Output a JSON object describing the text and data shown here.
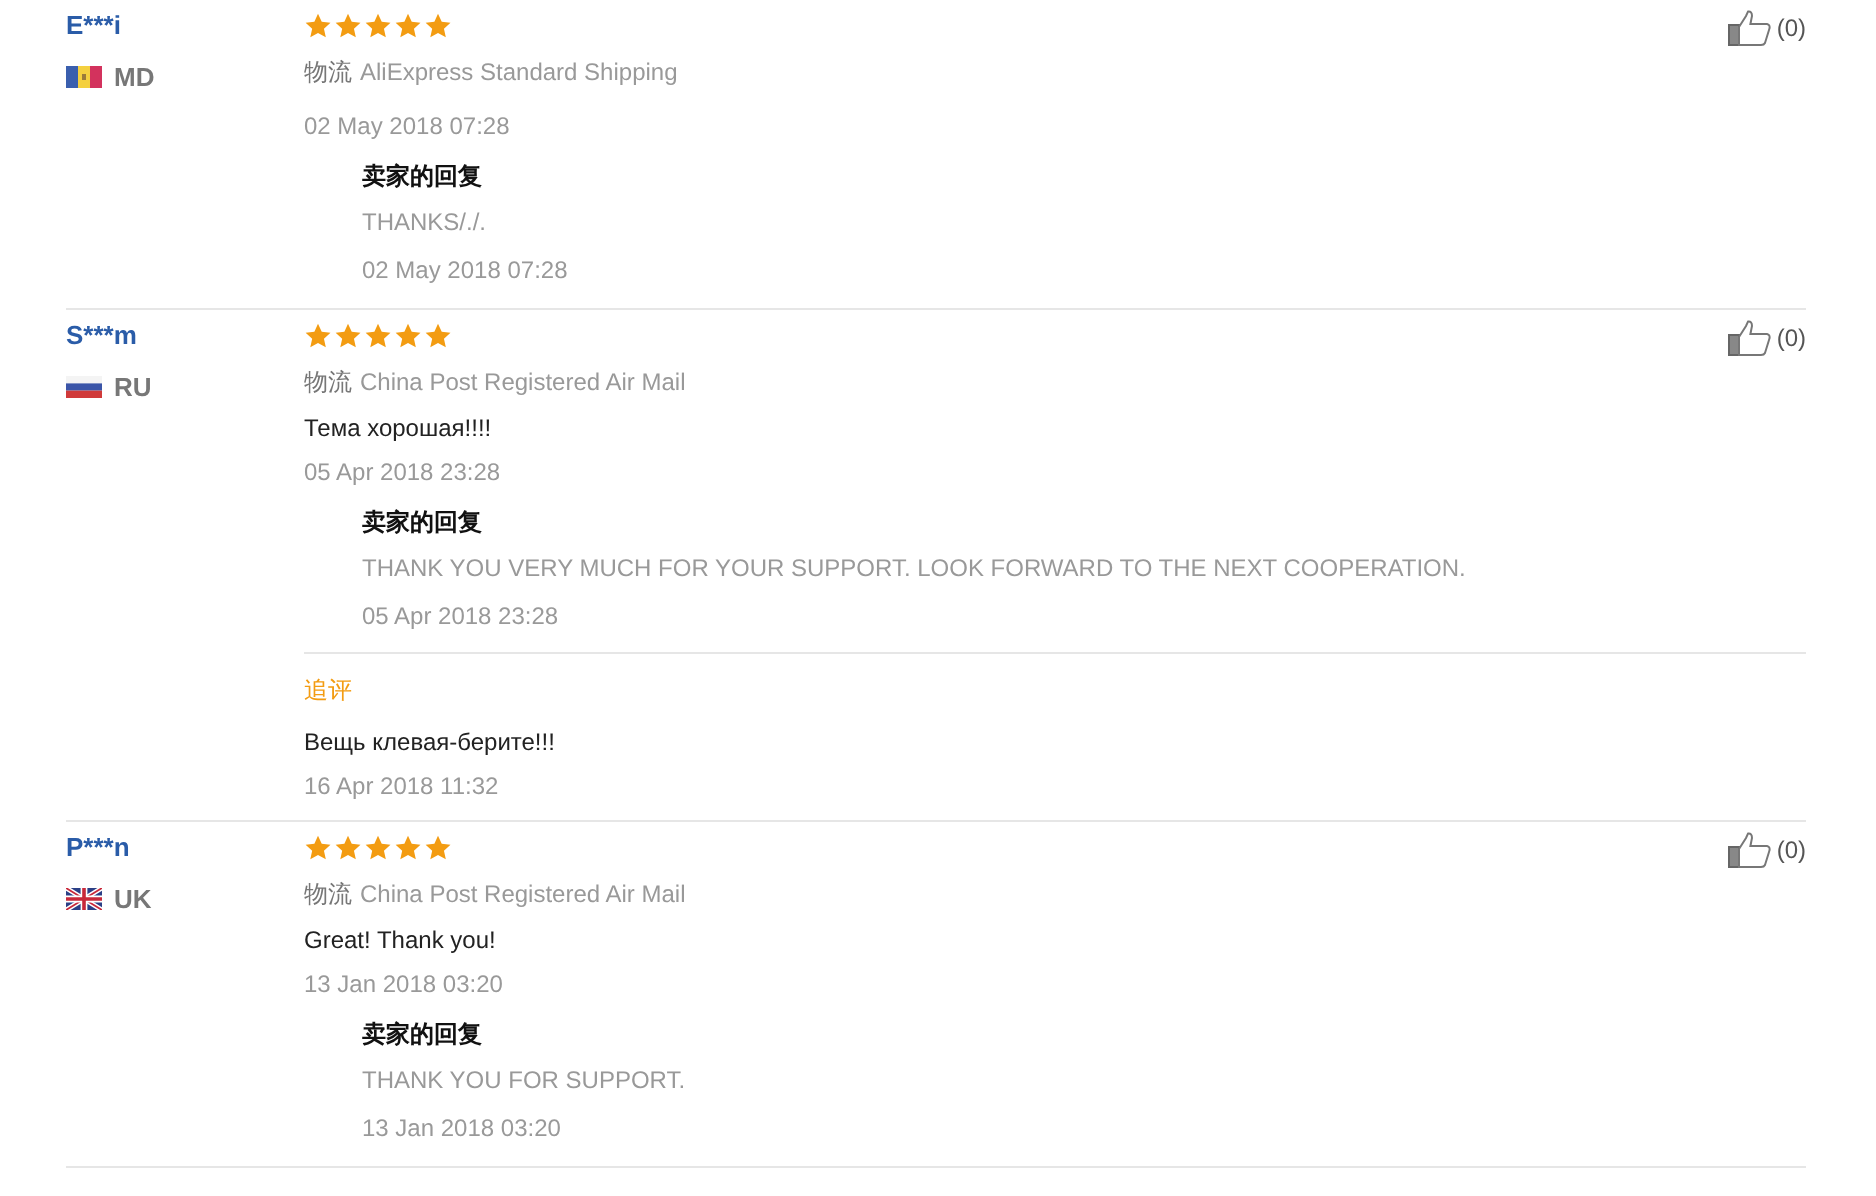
{
  "reviews": [
    {
      "user": "E***i",
      "country": "MD",
      "stars": 5,
      "shipping_label": "物流",
      "shipping": "AliExpress Standard Shipping",
      "date": "02 May 2018 07:28",
      "likes": "(0)",
      "reply": {
        "title": "卖家的回复",
        "text": "THANKS/./.",
        "date": "02 May 2018 07:28"
      }
    },
    {
      "user": "S***m",
      "country": "RU",
      "stars": 5,
      "shipping_label": "物流",
      "shipping": "China Post Registered Air Mail",
      "comment": "Тема хорошая!!!!",
      "date": "05 Apr 2018 23:28",
      "likes": "(0)",
      "reply": {
        "title": "卖家的回复",
        "text": "THANK YOU VERY MUCH FOR YOUR SUPPORT. LOOK FORWARD TO THE NEXT COOPERATION.",
        "date": "05 Apr 2018 23:28"
      },
      "followup": {
        "title": "追评",
        "text": "Вещь клевая-берите!!!",
        "date": "16 Apr 2018 11:32"
      }
    },
    {
      "user": "P***n",
      "country": "UK",
      "stars": 5,
      "shipping_label": "物流",
      "shipping": "China Post Registered Air Mail",
      "comment": "Great! Thank you!",
      "date": "13 Jan 2018 03:20",
      "likes": "(0)",
      "reply": {
        "title": "卖家的回复",
        "text": "THANK YOU FOR SUPPORT.",
        "date": "13 Jan 2018 03:20"
      }
    }
  ]
}
